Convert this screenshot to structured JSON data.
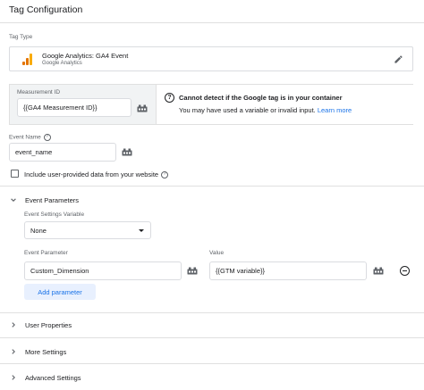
{
  "page": {
    "title": "Tag Configuration"
  },
  "tag_type": {
    "label": "Tag Type",
    "name": "Google Analytics: GA4 Event",
    "subtitle": "Google Analytics",
    "icons": {
      "logo": "google-analytics-icon",
      "edit": "pencil-icon"
    },
    "logo_colors": [
      "#f9ab00",
      "#e37400",
      "#e37400"
    ]
  },
  "measurement": {
    "label": "Measurement ID",
    "value": "{{GA4 Measurement ID}}",
    "variable_icon": "variable-picker-icon",
    "warning": {
      "icon": "question-circle-icon",
      "title": "Cannot detect if the Google tag is in your container",
      "text": "You may have used a variable or invalid input.",
      "link": "Learn more"
    }
  },
  "event_name": {
    "label": "Event Name",
    "help_icon": "help-icon",
    "value": "event_name",
    "variable_icon": "variable-picker-icon"
  },
  "user_data": {
    "label": "Include user-provided data from your website",
    "checked": false,
    "help_icon": "help-icon"
  },
  "event_parameters": {
    "title": "Event Parameters",
    "expanded": true,
    "settings_variable_label": "Event Settings Variable",
    "settings_variable_value": "None",
    "param_label": "Event Parameter",
    "value_label": "Value",
    "rows": [
      {
        "parameter": "Custom_Dimension",
        "value": "{{GTM variable}}"
      }
    ],
    "add_label": "Add parameter",
    "remove_icon": "remove-circle-icon"
  },
  "sections": [
    {
      "title": "User Properties",
      "expanded": false
    },
    {
      "title": "More Settings",
      "expanded": false
    },
    {
      "title": "Advanced Settings",
      "expanded": false
    }
  ],
  "colors": {
    "accent": "#1a73e8",
    "accent_bg": "#e8f0fe",
    "border": "#dadce0",
    "panel_bg": "#f1f3f4"
  }
}
